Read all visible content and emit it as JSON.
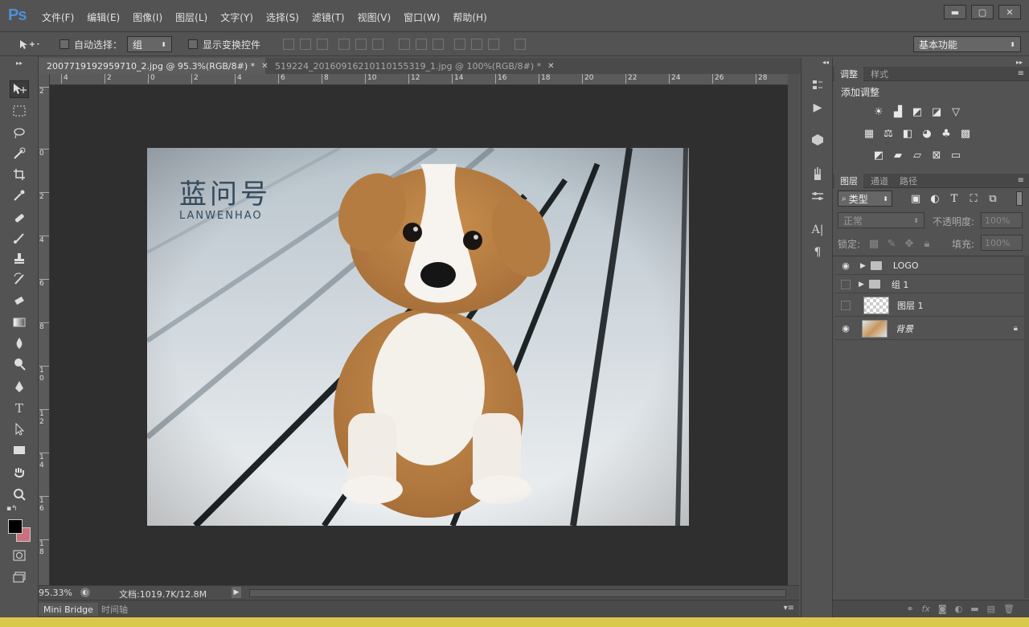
{
  "app": {
    "logo": "Ps"
  },
  "menus": [
    "文件(F)",
    "编辑(E)",
    "图像(I)",
    "图层(L)",
    "文字(Y)",
    "选择(S)",
    "滤镜(T)",
    "视图(V)",
    "窗口(W)",
    "帮助(H)"
  ],
  "window_controls": {
    "minimize": "▬",
    "restore": "▢",
    "close": "✕"
  },
  "options": {
    "auto_select_label": "自动选择：",
    "auto_select_value": "组",
    "show_transform_label": "显示变换控件",
    "workspace": "基本功能"
  },
  "doc_tabs": [
    {
      "label": "2007719192959710_2.jpg @ 95.3%(RGB/8#) *",
      "close": "✕"
    },
    {
      "label": "519224_20160916210110155319_1.jpg @ 100%(RGB/8#) *",
      "close": "✕"
    }
  ],
  "hruler_ticks": [
    "4",
    "2",
    "0",
    "2",
    "4",
    "6",
    "8",
    "10",
    "12",
    "14",
    "16",
    "18",
    "20",
    "22",
    "24",
    "26",
    "28"
  ],
  "vruler_ticks": [
    "2",
    "0",
    "2",
    "4",
    "6",
    "8",
    "1 0",
    "1 2",
    "1 4",
    "1 6",
    "1 8"
  ],
  "watermark": {
    "cn": "蓝问号",
    "en": "LANWENHAO"
  },
  "status": {
    "zoom": "95.33%",
    "doc_info": "文档:1019.7K/12.8M"
  },
  "bottom_tabs": [
    "Mini Bridge",
    "时间轴"
  ],
  "adjust_panel": {
    "tabs": [
      "调整",
      "样式"
    ],
    "title": "添加调整"
  },
  "layers_panel": {
    "tabs": [
      "图层",
      "通道",
      "路径"
    ],
    "filter_label": "类型",
    "blend_mode": "正常",
    "opacity_label": "不透明度:",
    "opacity_value": "100%",
    "lock_label": "锁定:",
    "fill_label": "填充:",
    "fill_value": "100%",
    "layers": [
      {
        "name": "LOGO",
        "type": "group",
        "visible": true
      },
      {
        "name": "组 1",
        "type": "group",
        "visible": false
      },
      {
        "name": "图层 1",
        "type": "layer",
        "visible": false
      },
      {
        "name": "背景",
        "type": "background",
        "visible": true,
        "locked": true
      }
    ]
  },
  "colors": {
    "foreground": "#000000",
    "background": "#c9717c",
    "ps_blue": "#4f8fd8"
  }
}
